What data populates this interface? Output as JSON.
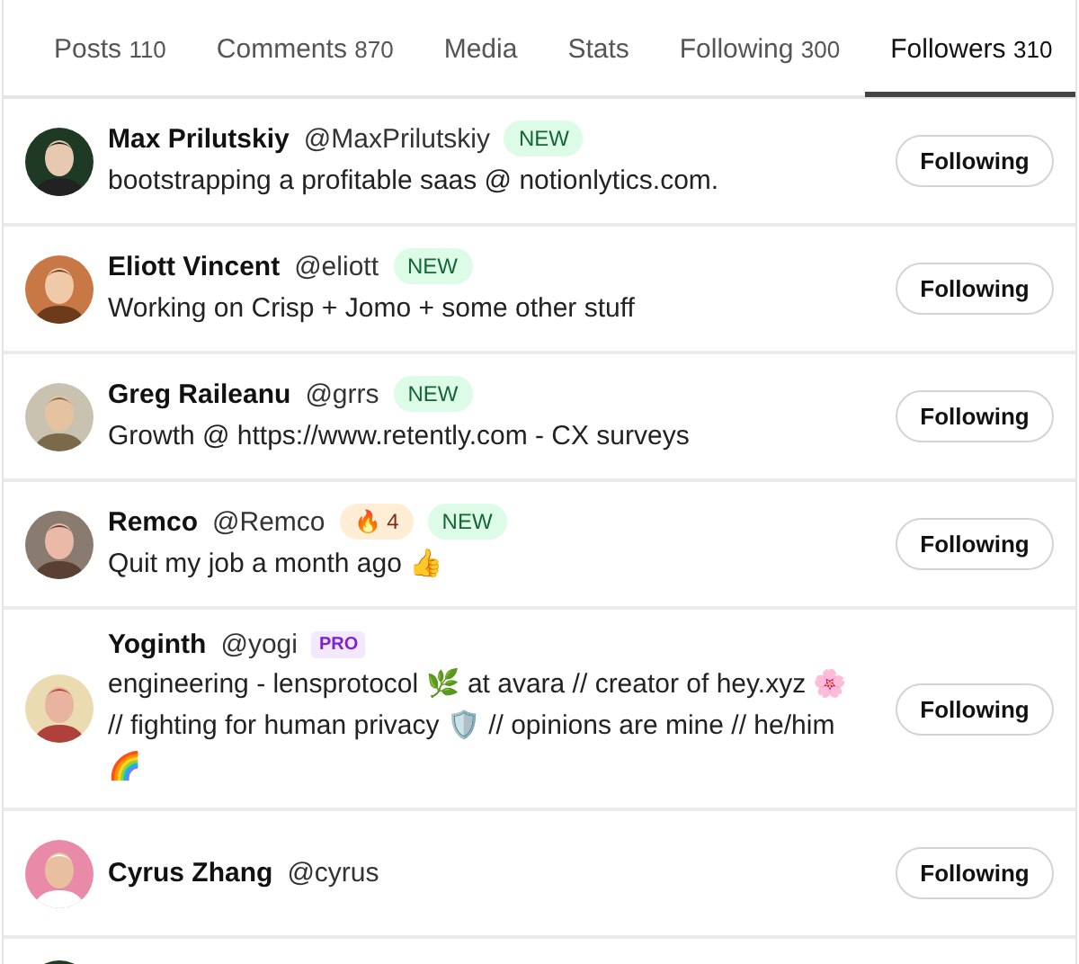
{
  "tabs": [
    {
      "label": "Posts",
      "count": "110",
      "selected": false
    },
    {
      "label": "Comments",
      "count": "870",
      "selected": false
    },
    {
      "label": "Media",
      "selected": false
    },
    {
      "label": "Stats",
      "selected": false
    },
    {
      "label": "Following",
      "count": "300",
      "selected": false
    },
    {
      "label": "Followers",
      "count": "310",
      "selected": true
    }
  ],
  "users": [
    {
      "name": "Max Prilutskiy",
      "handle": "@MaxPrilutskiy",
      "badges": [
        {
          "kind": "new",
          "text": "NEW"
        }
      ],
      "bio": "bootstrapping a profitable saas @ notionlytics.com.",
      "button": "Following"
    },
    {
      "name": "Eliott Vincent",
      "handle": "@eliott",
      "badges": [
        {
          "kind": "new",
          "text": "NEW"
        }
      ],
      "bio": "Working on Crisp + Jomo + some other stuff",
      "button": "Following"
    },
    {
      "name": "Greg Raileanu",
      "handle": "@grrs",
      "badges": [
        {
          "kind": "new",
          "text": "NEW"
        }
      ],
      "bio": "Growth @ https://www.retently.com - CX surveys",
      "button": "Following"
    },
    {
      "name": "Remco",
      "handle": "@Remco",
      "badges": [
        {
          "kind": "streak",
          "text": "🔥 4"
        },
        {
          "kind": "new",
          "text": "NEW"
        }
      ],
      "bio": "Quit my job a month ago 👍",
      "button": "Following"
    },
    {
      "name": "Yoginth",
      "handle": "@yogi",
      "badges": [
        {
          "kind": "pro",
          "text": "PRO"
        }
      ],
      "bio": "engineering - lensprotocol 🌿 at avara // creator of hey.xyz 🌸 // fighting for human privacy 🛡️ // opinions are mine // he/him 🌈",
      "button": "Following"
    },
    {
      "name": "Cyrus Zhang",
      "handle": "@cyrus",
      "button": "Following"
    }
  ]
}
